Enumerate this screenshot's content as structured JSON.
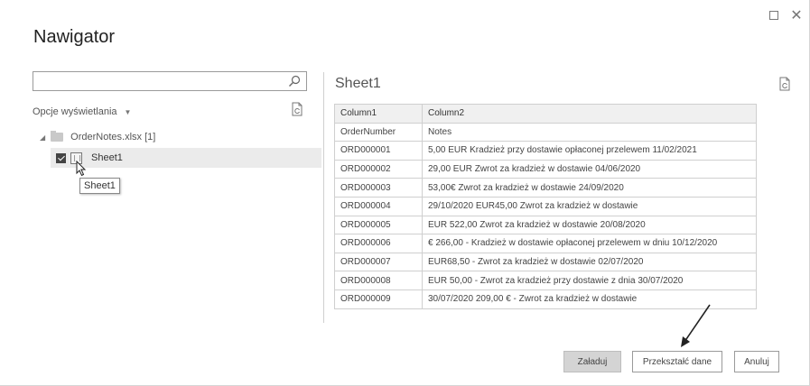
{
  "window": {
    "title": "Nawigator"
  },
  "left_panel": {
    "search": {
      "value": "",
      "placeholder": ""
    },
    "view_options_label": "Opcje wyświetlania",
    "tree": {
      "file": {
        "label": "OrderNotes.xlsx [1]"
      },
      "sheet": {
        "label": "Sheet1",
        "checked": true
      }
    },
    "tooltip": "Sheet1"
  },
  "preview": {
    "title": "Sheet1",
    "columns": [
      "Column1",
      "Column2"
    ],
    "rows": [
      [
        "OrderNumber",
        "Notes"
      ],
      [
        "ORD000001",
        "5,00 EUR Kradzież przy dostawie opłaconej przelewem 11/02/2021"
      ],
      [
        "ORD000002",
        "29,00 EUR Zwrot za kradzież w dostawie 04/06/2020"
      ],
      [
        "ORD000003",
        "53,00€ Zwrot za kradzież w dostawie 24/09/2020"
      ],
      [
        "ORD000004",
        "29/10/2020 EUR45,00 Zwrot za kradzież w dostawie"
      ],
      [
        "ORD000005",
        "EUR 522,00 Zwrot za kradzież w dostawie 20/08/2020"
      ],
      [
        "ORD000006",
        "€ 266,00 - Kradzież w dostawie opłaconej przelewem w dniu 10/12/2020"
      ],
      [
        "ORD000007",
        "EUR68,50 - Zwrot za kradzież w dostawie 02/07/2020"
      ],
      [
        "ORD000008",
        "EUR 50,00 - Zwrot za kradzież przy dostawie z dnia 30/07/2020"
      ],
      [
        "ORD000009",
        "30/07/2020 209,00 € - Zwrot za kradzież w dostawie"
      ]
    ]
  },
  "buttons": {
    "load": "Załaduj",
    "transform": "Przekształć dane",
    "cancel": "Anuluj"
  },
  "icons": {
    "search": "search-icon",
    "refresh": "refresh-icon",
    "maximize": "maximize-icon",
    "close": "close-icon",
    "folder": "folder-icon",
    "sheet": "sheet-icon"
  },
  "colors": {
    "selected_row": "#ebebeb",
    "header_bg": "#f0f0f0",
    "load_button_bg": "#d4d4d4"
  }
}
